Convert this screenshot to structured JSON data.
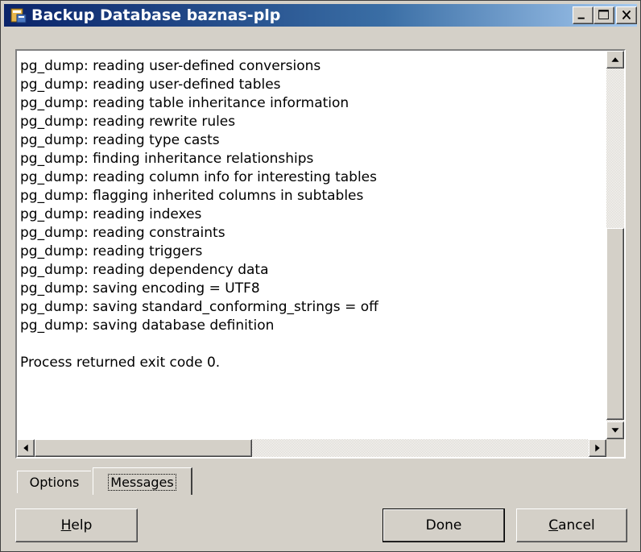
{
  "window": {
    "title": "Backup Database baznas-plp"
  },
  "log": {
    "lines": [
      "pg_dump: reading user-defined conversions",
      "pg_dump: reading user-defined tables",
      "pg_dump: reading table inheritance information",
      "pg_dump: reading rewrite rules",
      "pg_dump: reading type casts",
      "pg_dump: finding inheritance relationships",
      "pg_dump: reading column info for interesting tables",
      "pg_dump: flagging inherited columns in subtables",
      "pg_dump: reading indexes",
      "pg_dump: reading constraints",
      "pg_dump: reading triggers",
      "pg_dump: reading dependency data",
      "pg_dump: saving encoding = UTF8",
      "pg_dump: saving standard_conforming_strings = off",
      "pg_dump: saving database definition",
      "",
      "Process returned exit code 0."
    ]
  },
  "tabs": {
    "options": "Options",
    "messages": "Messages"
  },
  "buttons": {
    "help_accel": "H",
    "help_rest": "elp",
    "done": "Done",
    "cancel_accel": "C",
    "cancel_rest": "ancel"
  }
}
